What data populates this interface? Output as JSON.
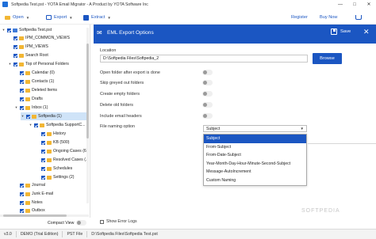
{
  "window": {
    "title": "Softpedia Test.pst - YOTA Email Migrator - A Product by YOTA Software Inc",
    "minimize": "—",
    "maximize": "□",
    "close": "✕"
  },
  "toolbar": {
    "open": "Open",
    "export": "Export",
    "extract": "Extract",
    "register": "Register",
    "buy_now": "Buy Now",
    "help": "Help"
  },
  "tree": {
    "items": [
      {
        "label": "Softpedia Test.pst"
      },
      {
        "label": "IPM_COMMON_VIEWS"
      },
      {
        "label": "IPM_VIEWS"
      },
      {
        "label": "Search Root"
      },
      {
        "label": "Top of Personal Folders"
      },
      {
        "label": "Calendar (0)"
      },
      {
        "label": "Contacts (1)"
      },
      {
        "label": "Deleted Items"
      },
      {
        "label": "Drafts"
      },
      {
        "label": "Inbox (1)"
      },
      {
        "label": "Softpedia (1)"
      },
      {
        "label": "Softpedia SupportC..."
      },
      {
        "label": "History"
      },
      {
        "label": "KB (500)"
      },
      {
        "label": "Ongoing Cases (6)"
      },
      {
        "label": "Resolved Cases (..."
      },
      {
        "label": "Schedules"
      },
      {
        "label": "Settings (2)"
      },
      {
        "label": "Journal"
      },
      {
        "label": "Junk E-mail"
      },
      {
        "label": "Notes"
      },
      {
        "label": "Outbox"
      }
    ],
    "compact_view": "Compact View"
  },
  "panel": {
    "title": "EML Export Options",
    "save": "Save",
    "location_label": "Location",
    "location_value": "D:\\Softpedia Files\\Softpedia_2",
    "browse": "Browse",
    "options": [
      {
        "label": "Open folder after export is done",
        "enabled": false
      },
      {
        "label": "Skip greyed out folders",
        "enabled": false
      },
      {
        "label": "Create empty folders",
        "enabled": false
      },
      {
        "label": "Delete old folders",
        "enabled": false
      },
      {
        "label": "Include email headers",
        "enabled": false
      }
    ],
    "naming_label": "File naming option",
    "naming_selected": "Subject",
    "naming_options": [
      "Subject",
      "From-Subject",
      "From-Date-Subject",
      "Year-Month-Day-Hour-Minute-Second-Subject",
      "Message-AutoIncrement",
      "Custom Naming"
    ],
    "show_error_logs": "Show Error Logs"
  },
  "watermark": "SOFTPEDIA",
  "status": {
    "version": "v3.0",
    "edition": "DEMO (Trial Edition)",
    "file_type": "PST File",
    "path": "D:\\Softpedia Files\\Softpedia Test.pst"
  },
  "colors": {
    "accent": "#1b56c2",
    "folder": "#f2b634"
  }
}
